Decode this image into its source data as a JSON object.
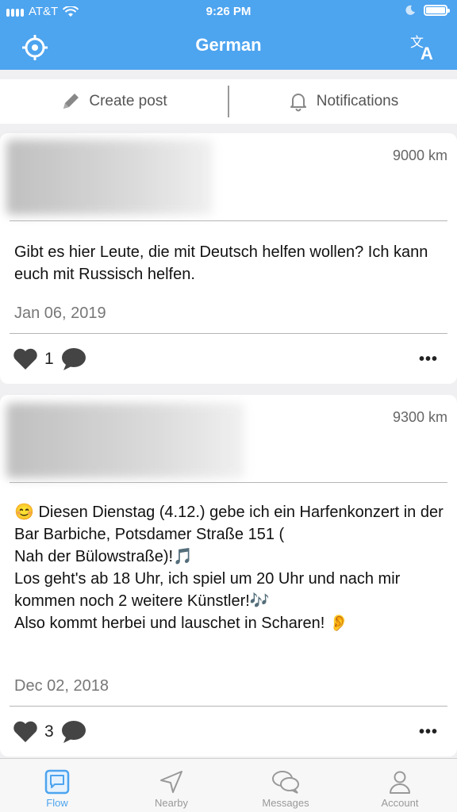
{
  "status_bar": {
    "carrier": "AT&T",
    "time": "9:26 PM",
    "icons": [
      "signal-icon",
      "wifi-icon",
      "moon-icon",
      "battery-icon"
    ]
  },
  "nav": {
    "title": "German",
    "left_icon": "locate-icon",
    "right_icon": "translate-icon"
  },
  "actions": {
    "create_post": "Create post",
    "notifications": "Notifications"
  },
  "posts": [
    {
      "distance": "9000 km",
      "content": "Gibt es hier Leute, die mit Deutsch helfen wollen? Ich kann euch mit Russisch helfen.",
      "date": "Jan 06, 2019",
      "likes": "1"
    },
    {
      "distance": "9300 km",
      "content": "😊 Diesen Dienstag (4.12.) gebe ich ein Harfenkonzert in der Bar Barbiche, Potsdamer Straße 151 (\nNah der Bülowstraße)!🎵\nLos geht's ab 18 Uhr, ich spiel um 20 Uhr und nach mir kommen noch 2 weitere Künstler!🎶\nAlso kommt herbei und lauschet in Scharen! 👂",
      "date": "Dec 02, 2018",
      "likes": "3"
    }
  ],
  "more_label": "•••",
  "tabs": [
    {
      "label": "Flow",
      "icon": "flow-icon"
    },
    {
      "label": "Nearby",
      "icon": "nearby-icon"
    },
    {
      "label": "Messages",
      "icon": "messages-icon"
    },
    {
      "label": "Account",
      "icon": "account-icon"
    }
  ],
  "colors": {
    "primary": "#4da4ef",
    "background": "#f0f0f2"
  }
}
